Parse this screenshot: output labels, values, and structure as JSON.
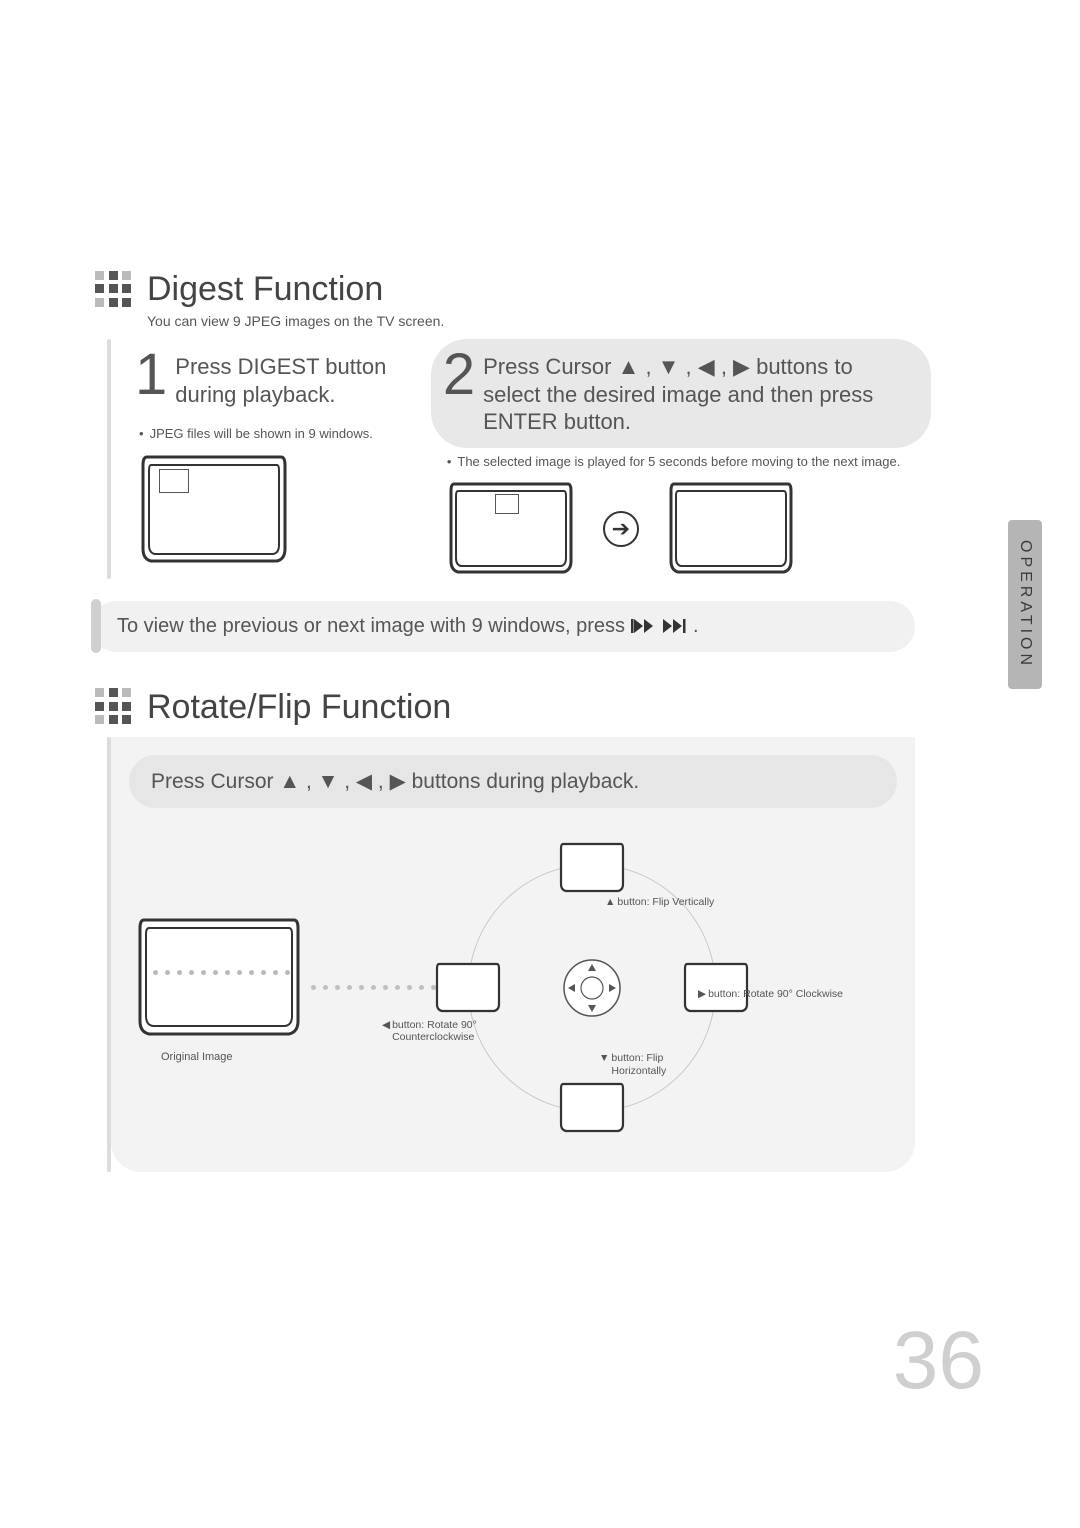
{
  "side_tab": "OPERATION",
  "page_number": "36",
  "digest": {
    "title": "Digest Function",
    "subtitle": "You can view 9 JPEG images on the TV screen.",
    "step1": {
      "num": "1",
      "text": "Press DIGEST button during playback.",
      "note": "JPEG files will be shown in 9 windows."
    },
    "step2": {
      "num": "2",
      "text_before": "Press Cursor ",
      "text_after": " buttons to select the desired image and then press ENTER button.",
      "arrows": "▲ , ▼ , ◀ , ▶",
      "note": "The selected image is played for 5 seconds before moving to the next image."
    },
    "footer_before": "To view the previous or next image with 9 windows, press ",
    "footer_icons": "⏮⏮  ⏭⏭",
    "footer_dot": " ."
  },
  "rotate": {
    "title": "Rotate/Flip Function",
    "instruction_before": "Press Cursor ",
    "instruction_arrows": "▲ , ▼ , ◀ , ▶",
    "instruction_after": "  buttons during playback.",
    "original_label": "Original Image",
    "cap_up": " button: Flip Vertically",
    "cap_down": " button: Flip Horizontally",
    "cap_left": " button: Rotate 90° Counterclockwise",
    "cap_right": " button: Rotate 90° Clockwise",
    "tri_up": "▲",
    "tri_down": "▼",
    "tri_left": "◀",
    "tri_right": "▶"
  }
}
